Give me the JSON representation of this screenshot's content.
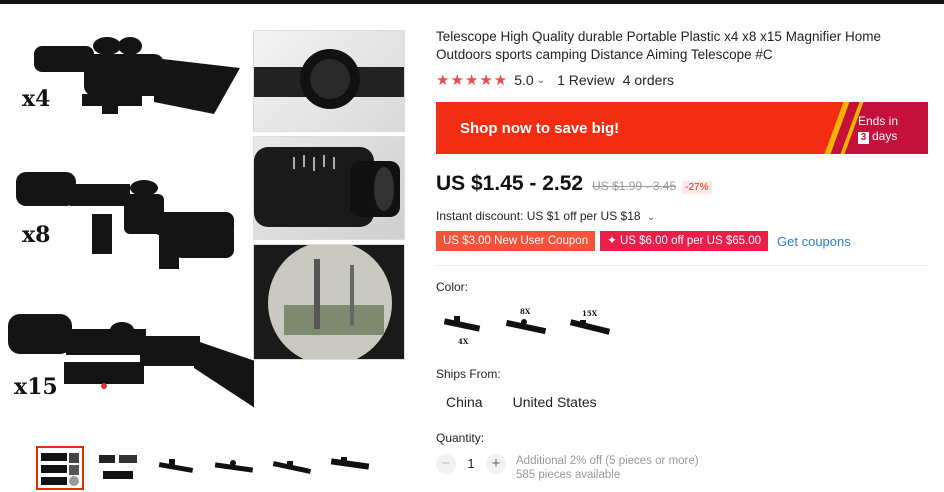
{
  "gallery": {
    "scope_labels": [
      "x4",
      "x8",
      "x15"
    ],
    "thumbnails": [
      {
        "name": "thumb-1",
        "active": true
      },
      {
        "name": "thumb-2",
        "active": false
      },
      {
        "name": "thumb-3",
        "active": false
      },
      {
        "name": "thumb-4",
        "active": false
      },
      {
        "name": "thumb-5",
        "active": false
      },
      {
        "name": "thumb-6",
        "active": false
      }
    ]
  },
  "product": {
    "title": "Telescope High Quality durable Portable Plastic x4 x8 x15 Magnifier Home Outdoors sports camping Distance Aiming Telescope #C",
    "stars": "★★★★★",
    "rating": "5.0",
    "reviews": "1 Review",
    "orders": "4 orders"
  },
  "promo": {
    "text": "Shop now to save big!",
    "ends_in": "Ends in",
    "days_count": "3",
    "days_label": "days"
  },
  "price": {
    "current": "US $1.45 - 2.52",
    "original": "US $1.99 - 3.45",
    "discount": "-27%"
  },
  "instant_discount": "Instant discount: US $1 off per US $18",
  "coupons": {
    "new_user": "US $3.00 New User Coupon",
    "store": "✦ US $6.00 off per US $65.00",
    "get": "Get coupons"
  },
  "color": {
    "label": "Color:",
    "options": [
      "4X",
      "8X",
      "15X"
    ]
  },
  "ships": {
    "label": "Ships From:",
    "options": [
      "China",
      "United States"
    ]
  },
  "quantity": {
    "label": "Quantity:",
    "minus": "−",
    "value": "1",
    "plus": "+",
    "discount_note": "Additional 2% off (5 pieces or more)",
    "available": "585 pieces available"
  },
  "colors": {
    "accent": "#f22d13",
    "price_text": "#111111",
    "coupon_link": "#2a7ec8",
    "star": "#f04a4a"
  }
}
